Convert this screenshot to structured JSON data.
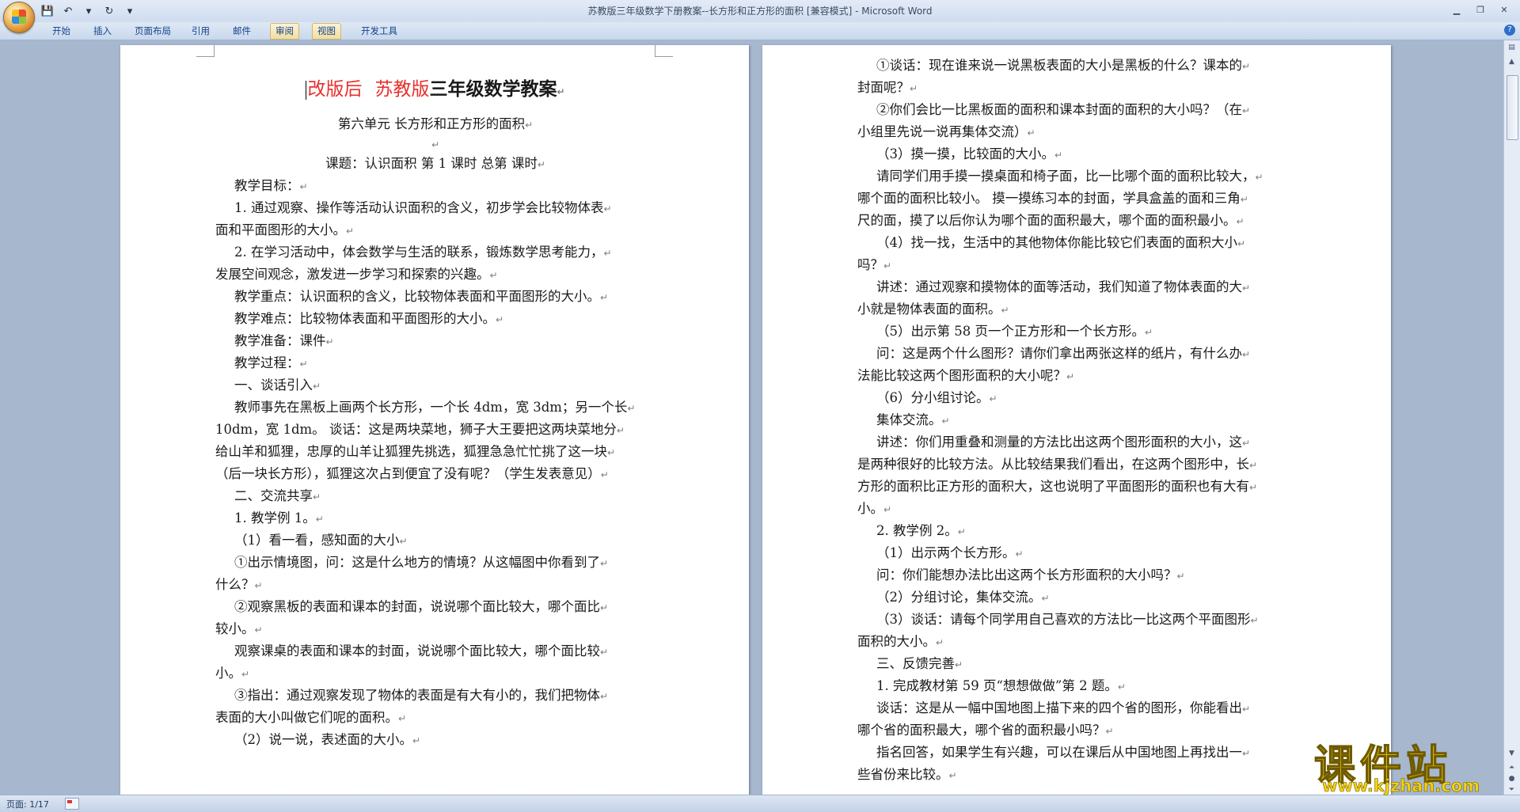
{
  "window": {
    "title": "苏教版三年级数学下册教案--长方形和正方形的面积 [兼容模式] - Microsoft Word"
  },
  "quick_access": [
    {
      "name": "save-icon",
      "glyph": "💾"
    },
    {
      "name": "undo-icon",
      "glyph": "↶"
    },
    {
      "name": "undo-dropdown-icon",
      "glyph": "▾"
    },
    {
      "name": "redo-icon",
      "glyph": "↻"
    },
    {
      "name": "customize-qat-icon",
      "glyph": "▾"
    }
  ],
  "ribbon": {
    "tabs": [
      "开始",
      "插入",
      "页面布局",
      "引用",
      "邮件",
      "审阅",
      "视图",
      "开发工具"
    ],
    "highlighted": [
      "审阅",
      "视图"
    ]
  },
  "status": {
    "page": "页面: 1/17"
  },
  "watermark": {
    "title": "课件站",
    "url": "www.kjzhan.com"
  },
  "document": {
    "left": {
      "title_red1": "改版后",
      "title_red2": "苏教版",
      "title_black": "三年级数学教案",
      "unit": "第六单元 长方形和正方形的面积",
      "lesson": "课题：认识面积 第 1 课时 总第 课时",
      "lines": [
        {
          "t": "教学目标：",
          "ind": true
        },
        {
          "t": "1. 通过观察、操作等活动认识面积的含义，初步学会比较物体表",
          "ind": true
        },
        {
          "t": "面和平面图形的大小。",
          "ind": false
        },
        {
          "t": "2. 在学习活动中，体会数学与生活的联系，锻炼数学思考能力，",
          "ind": true
        },
        {
          "t": "发展空间观念，激发进一步学习和探索的兴趣。",
          "ind": false
        },
        {
          "t": "教学重点：认识面积的含义，比较物体表面和平面图形的大小。",
          "ind": true
        },
        {
          "t": "教学难点：比较物体表面和平面图形的大小。",
          "ind": true
        },
        {
          "t": "教学准备：课件",
          "ind": true
        },
        {
          "t": "教学过程：",
          "ind": true
        },
        {
          "t": "一、谈话引入",
          "ind": true
        },
        {
          "t": "教师事先在黑板上画两个长方形，一个长 4dm，宽 3dm；另一个长",
          "ind": true
        },
        {
          "t": "10dm，宽 1dm。 谈话：这是两块菜地，狮子大王要把这两块菜地分",
          "ind": false
        },
        {
          "t": "给山羊和狐狸，忠厚的山羊让狐狸先挑选，狐狸急急忙忙挑了这一块",
          "ind": false
        },
        {
          "t": "（后一块长方形），狐狸这次占到便宜了没有呢？（学生发表意见）",
          "ind": false
        },
        {
          "t": "二、交流共享",
          "ind": true
        },
        {
          "t": "1. 教学例 1。",
          "ind": true
        },
        {
          "t": "（1）看一看，感知面的大小",
          "ind": true
        },
        {
          "t": "①出示情境图，问：这是什么地方的情境？从这幅图中你看到了",
          "ind": true
        },
        {
          "t": "什么？",
          "ind": false
        },
        {
          "t": "②观察黑板的表面和课本的封面，说说哪个面比较大，哪个面比",
          "ind": true
        },
        {
          "t": "较小。",
          "ind": false
        },
        {
          "t": "观察课桌的表面和课本的封面，说说哪个面比较大，哪个面比较",
          "ind": true
        },
        {
          "t": "小。",
          "ind": false
        },
        {
          "t": "③指出：通过观察发现了物体的表面是有大有小的，我们把物体",
          "ind": true
        },
        {
          "t": "表面的大小叫做它们呢的面积。",
          "ind": false
        },
        {
          "t": "（2）说一说，表述面的大小。",
          "ind": true
        }
      ]
    },
    "right": {
      "lines": [
        {
          "t": "①谈话：现在谁来说一说黑板表面的大小是黑板的什么？课本的",
          "ind": true
        },
        {
          "t": "封面呢？",
          "ind": false
        },
        {
          "t": "②你们会比一比黑板面的面积和课本封面的面积的大小吗？（在",
          "ind": true
        },
        {
          "t": "小组里先说一说再集体交流）",
          "ind": false
        },
        {
          "t": "（3）摸一摸，比较面的大小。",
          "ind": true
        },
        {
          "t": "请同学们用手摸一摸桌面和椅子面，比一比哪个面的面积比较大，",
          "ind": true
        },
        {
          "t": "哪个面的面积比较小。 摸一摸练习本的封面，学具盒盖的面和三角",
          "ind": false
        },
        {
          "t": "尺的面，摸了以后你认为哪个面的面积最大，哪个面的面积最小。",
          "ind": false
        },
        {
          "t": "（4）找一找，生活中的其他物体你能比较它们表面的面积大小",
          "ind": true
        },
        {
          "t": "吗？",
          "ind": false
        },
        {
          "t": "讲述：通过观察和摸物体的面等活动，我们知道了物体表面的大",
          "ind": true
        },
        {
          "t": "小就是物体表面的面积。",
          "ind": false
        },
        {
          "t": "（5）出示第 58 页一个正方形和一个长方形。",
          "ind": true
        },
        {
          "t": "问：这是两个什么图形？请你们拿出两张这样的纸片，有什么办",
          "ind": true
        },
        {
          "t": "法能比较这两个图形面积的大小呢？",
          "ind": false
        },
        {
          "t": "（6）分小组讨论。",
          "ind": true
        },
        {
          "t": "集体交流。",
          "ind": true
        },
        {
          "t": "讲述：你们用重叠和测量的方法比出这两个图形面积的大小，这",
          "ind": true
        },
        {
          "t": "是两种很好的比较方法。从比较结果我们看出，在这两个图形中，长",
          "ind": false
        },
        {
          "t": "方形的面积比正方形的面积大，这也说明了平面图形的面积也有大有",
          "ind": false
        },
        {
          "t": "小。",
          "ind": false
        },
        {
          "t": "2. 教学例 2。",
          "ind": true
        },
        {
          "t": "（1）出示两个长方形。",
          "ind": true
        },
        {
          "t": "问：你们能想办法比出这两个长方形面积的大小吗？",
          "ind": true
        },
        {
          "t": "（2）分组讨论，集体交流。",
          "ind": true
        },
        {
          "t": "（3）谈话：请每个同学用自己喜欢的方法比一比这两个平面图形",
          "ind": true
        },
        {
          "t": "面积的大小。",
          "ind": false
        },
        {
          "t": "三、反馈完善",
          "ind": true
        },
        {
          "t": "1. 完成教材第 59 页“想想做做”第 2 题。",
          "ind": true
        },
        {
          "t": "谈话：这是从一幅中国地图上描下来的四个省的图形，你能看出",
          "ind": true
        },
        {
          "t": "哪个省的面积最大，哪个省的面积最小吗？",
          "ind": false
        },
        {
          "t": "指名回答，如果学生有兴趣，可以在课后从中国地图上再找出一",
          "ind": true
        },
        {
          "t": "些省份来比较。",
          "ind": false
        }
      ]
    }
  }
}
